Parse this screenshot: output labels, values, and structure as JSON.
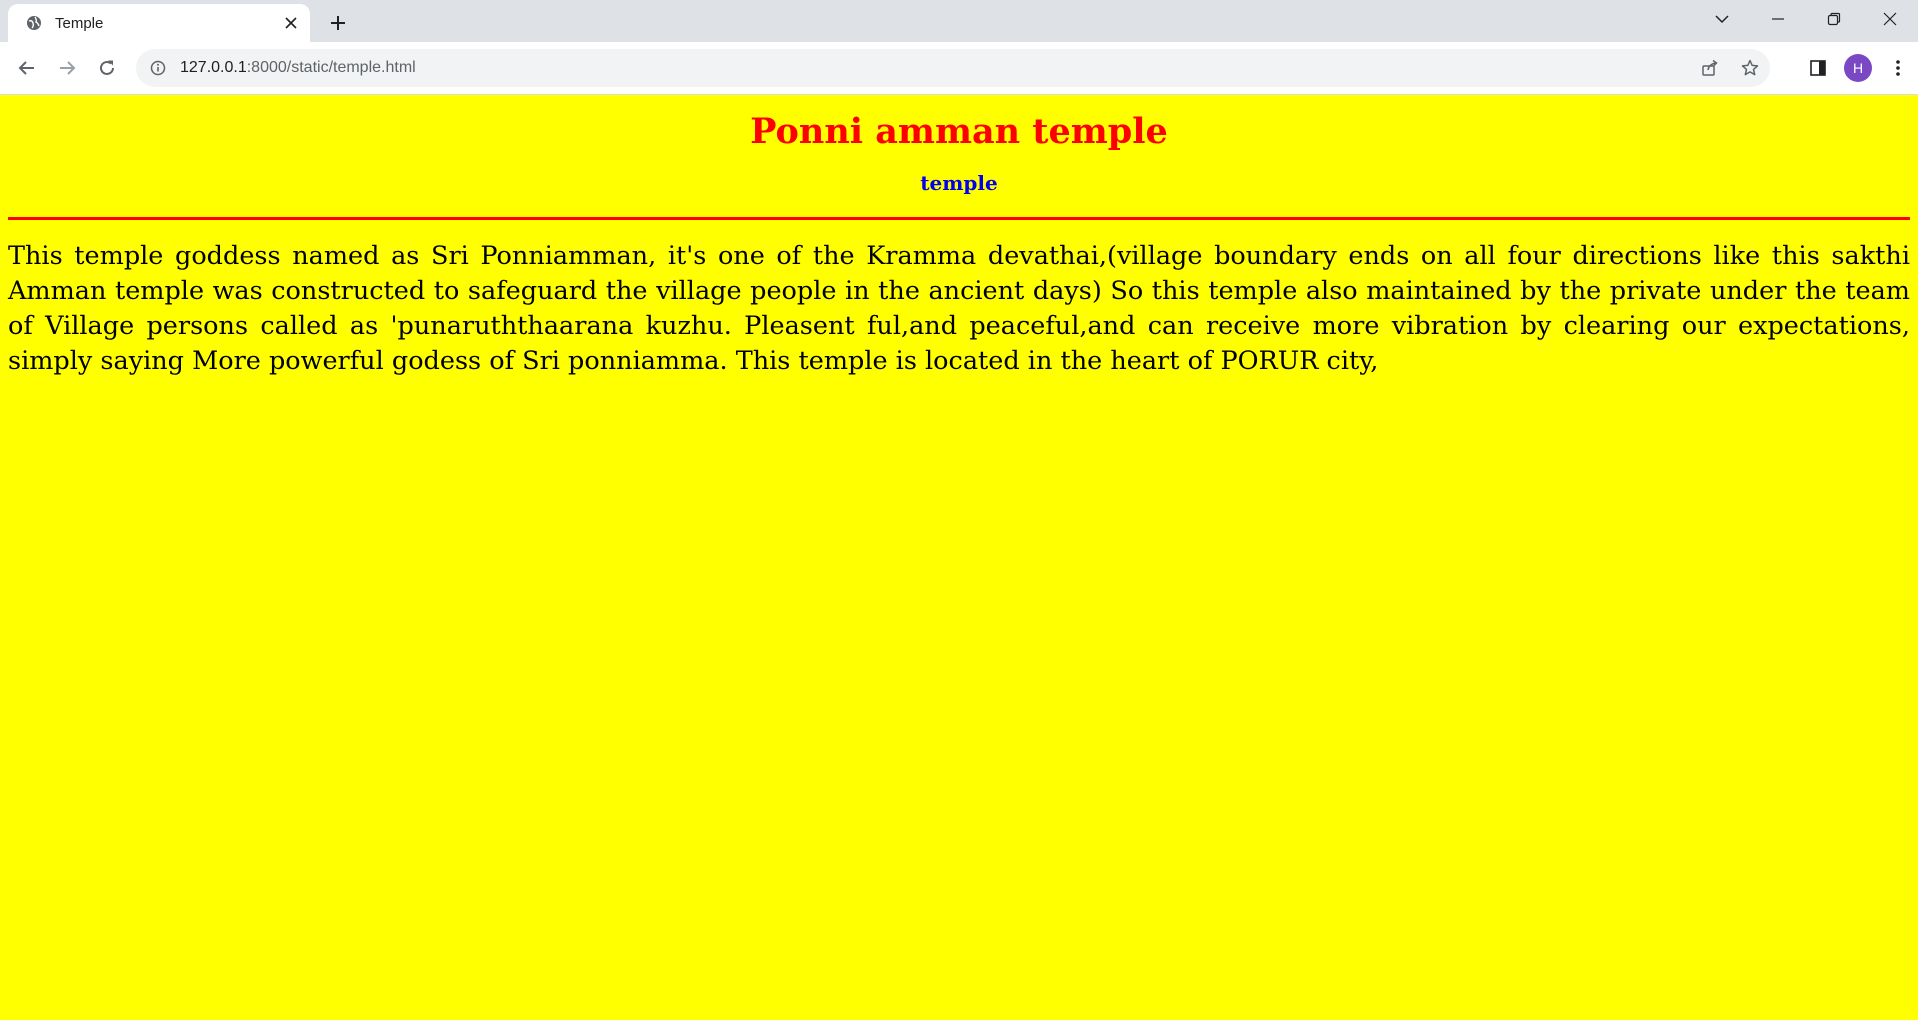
{
  "browser": {
    "tab": {
      "title": "Temple",
      "favicon": "globe-icon"
    },
    "address": {
      "host": "127.0.0.1",
      "rest": ":8000/static/temple.html"
    },
    "profile_initial": "H",
    "profile_color": "#7b48c4"
  },
  "page": {
    "background": "#ffff00",
    "heading": "Ponni amman temple",
    "heading_color": "#ff0000",
    "subheading": "temple",
    "subheading_color": "#0000ee",
    "rule_color": "#ff0000",
    "paragraph": "This temple goddess named as Sri Ponniamman, it's one of the Kramma devathai,(village boundary ends on all four directions like this sakthi Amman temple was constructed to safeguard the village people in the ancient days) So this temple also maintained by the private under the team of Village persons called as 'punaruththaarana kuzhu. Pleasent ful,and peaceful,and can receive more vibration by clearing our expectations, simply saying More powerful godess of Sri ponniamma. This temple is located in the heart of PORUR city,"
  }
}
